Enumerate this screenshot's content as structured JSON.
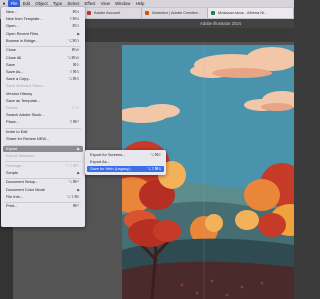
{
  "menubar": {
    "items": [
      "File",
      "Edit",
      "Object",
      "Type",
      "Select",
      "Effect",
      "View",
      "Window",
      "Help"
    ],
    "active_index": 0
  },
  "tabs": [
    {
      "label": "Adobe Account"
    },
    {
      "label": "Illustrator | Adobe Creative..."
    },
    {
      "label": "Muskaan.sivus - Athena Ni..."
    }
  ],
  "app": {
    "title": "Adobe Illustrator 2024"
  },
  "file_menu": {
    "items": [
      {
        "label": "New...",
        "shortcut": "⌘N",
        "disabled": false
      },
      {
        "label": "New from Template...",
        "shortcut": "⇧⌘N",
        "disabled": false
      },
      {
        "label": "Open...",
        "shortcut": "⌘O",
        "disabled": false
      },
      {
        "label": "Open Recent Files",
        "shortcut": "",
        "disabled": false,
        "submenu": true
      },
      {
        "label": "Browse in Bridge...",
        "shortcut": "⌥⌘O",
        "disabled": false
      },
      {
        "label": "Close",
        "shortcut": "⌘W",
        "disabled": false,
        "sep_before": true
      },
      {
        "label": "Close All",
        "shortcut": "⌥⌘W",
        "disabled": false
      },
      {
        "label": "Save",
        "shortcut": "⌘S",
        "disabled": false
      },
      {
        "label": "Save As...",
        "shortcut": "⇧⌘S",
        "disabled": false
      },
      {
        "label": "Save a Copy...",
        "shortcut": "⌥⌘S",
        "disabled": false
      },
      {
        "label": "Save Selected Slices...",
        "shortcut": "",
        "disabled": true
      },
      {
        "label": "Version History",
        "shortcut": "",
        "disabled": false
      },
      {
        "label": "Save as Template...",
        "shortcut": "",
        "disabled": false
      },
      {
        "label": "Revert",
        "shortcut": "F12",
        "disabled": true
      },
      {
        "label": "Search Adobe Stock...",
        "shortcut": "",
        "disabled": false
      },
      {
        "label": "Place...",
        "shortcut": "⇧⌘P",
        "disabled": false
      },
      {
        "label": "Invite to Edit",
        "shortcut": "",
        "disabled": false,
        "sep_before": true
      },
      {
        "label": "Share for Review NEW...",
        "shortcut": "",
        "disabled": false
      },
      {
        "label": "Export",
        "shortcut": "",
        "disabled": false,
        "submenu": true,
        "highlighted": true,
        "sep_before": true
      },
      {
        "label": "Export Selection...",
        "shortcut": "",
        "disabled": true
      },
      {
        "label": "Package...",
        "shortcut": "⌥⇧⌘P",
        "disabled": true,
        "sep_before": true
      },
      {
        "label": "Scripts",
        "shortcut": "",
        "disabled": false,
        "submenu": true
      },
      {
        "label": "Document Setup...",
        "shortcut": "⌥⌘P",
        "disabled": false,
        "sep_before": true
      },
      {
        "label": "Document Color Mode",
        "shortcut": "",
        "disabled": false,
        "submenu": true
      },
      {
        "label": "File Info...",
        "shortcut": "⌥⇧⌘I",
        "disabled": false
      },
      {
        "label": "Print...",
        "shortcut": "⌘P",
        "disabled": false,
        "sep_before": true
      }
    ]
  },
  "export_submenu": {
    "items": [
      {
        "label": "Export for Screens...",
        "shortcut": "⌥⌘E",
        "selected": false
      },
      {
        "label": "Export As...",
        "shortcut": "",
        "selected": false
      },
      {
        "label": "Save for Web (Legacy)...",
        "shortcut": "⌥⇧⌘S",
        "selected": true
      }
    ]
  },
  "colors": {
    "menu_bg": "#e9e7ee",
    "highlight": "#8e8c93",
    "selection": "#3a6ee8",
    "sky": "#4a93ad",
    "cloud": "#f2c7a7",
    "foliage_red": "#c63a28",
    "foliage_orange": "#e9863a",
    "hill": "#2f4a51"
  }
}
